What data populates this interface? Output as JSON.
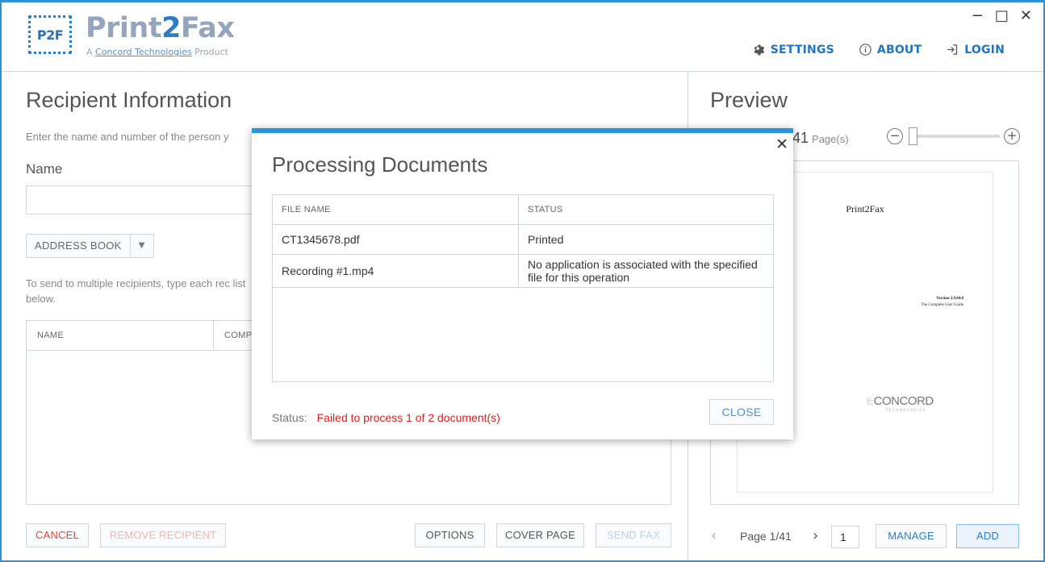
{
  "app": {
    "logo_text": "P2F",
    "brand_prefix": "Print",
    "brand_accent": "2",
    "brand_suffix": "Fax",
    "tagline_pre": "A ",
    "tagline_link": "Concord Technologies",
    "tagline_post": " Product",
    "accent_color": "#2f7cc4"
  },
  "window_controls": {
    "minimize": "−",
    "maximize": "□",
    "close": "✕"
  },
  "topnav": {
    "settings": "SETTINGS",
    "about": "ABOUT",
    "login": "LOGIN"
  },
  "recipient": {
    "title": "Recipient Information",
    "description": "Enter the name and number of the person y",
    "name_label": "Name",
    "name_value": "",
    "address_book": "ADDRESS BOOK",
    "multi_hint": "To send to multiple recipients, type each rec list below.",
    "table_headers": [
      "NAME",
      "COMP"
    ]
  },
  "bottom_buttons": {
    "cancel": "CANCEL",
    "remove": "REMOVE RECIPIENT",
    "options": "OPTIONS",
    "cover": "COVER PAGE",
    "send": "SEND FAX"
  },
  "preview": {
    "title": "Preview",
    "page_count": "41",
    "page_unit": "Page(s)",
    "doc_title": "Print2Fax",
    "doc_version": "Version 2.9.84.0",
    "doc_subtitle": "The Complete User Guide",
    "doc_logo": "CONCORD",
    "doc_logo_sub": "TECHNOLOGIES",
    "page_label": "Page 1/41",
    "page_input": "1",
    "manage": "MANAGE",
    "add": "ADD"
  },
  "dialog": {
    "title": "Processing Documents",
    "close_x": "✕",
    "headers": {
      "file": "FILE NAME",
      "status": "STATUS"
    },
    "rows": [
      {
        "file": "CT1345678.pdf",
        "status": "Printed"
      },
      {
        "file": "Recording #1.mp4",
        "status": "No application is associated with the specified file for this operation"
      }
    ],
    "status_label": "Status:",
    "status_text": "Failed to process 1 of 2 document(s)",
    "status_color": "#e02020",
    "close_button": "CLOSE"
  }
}
